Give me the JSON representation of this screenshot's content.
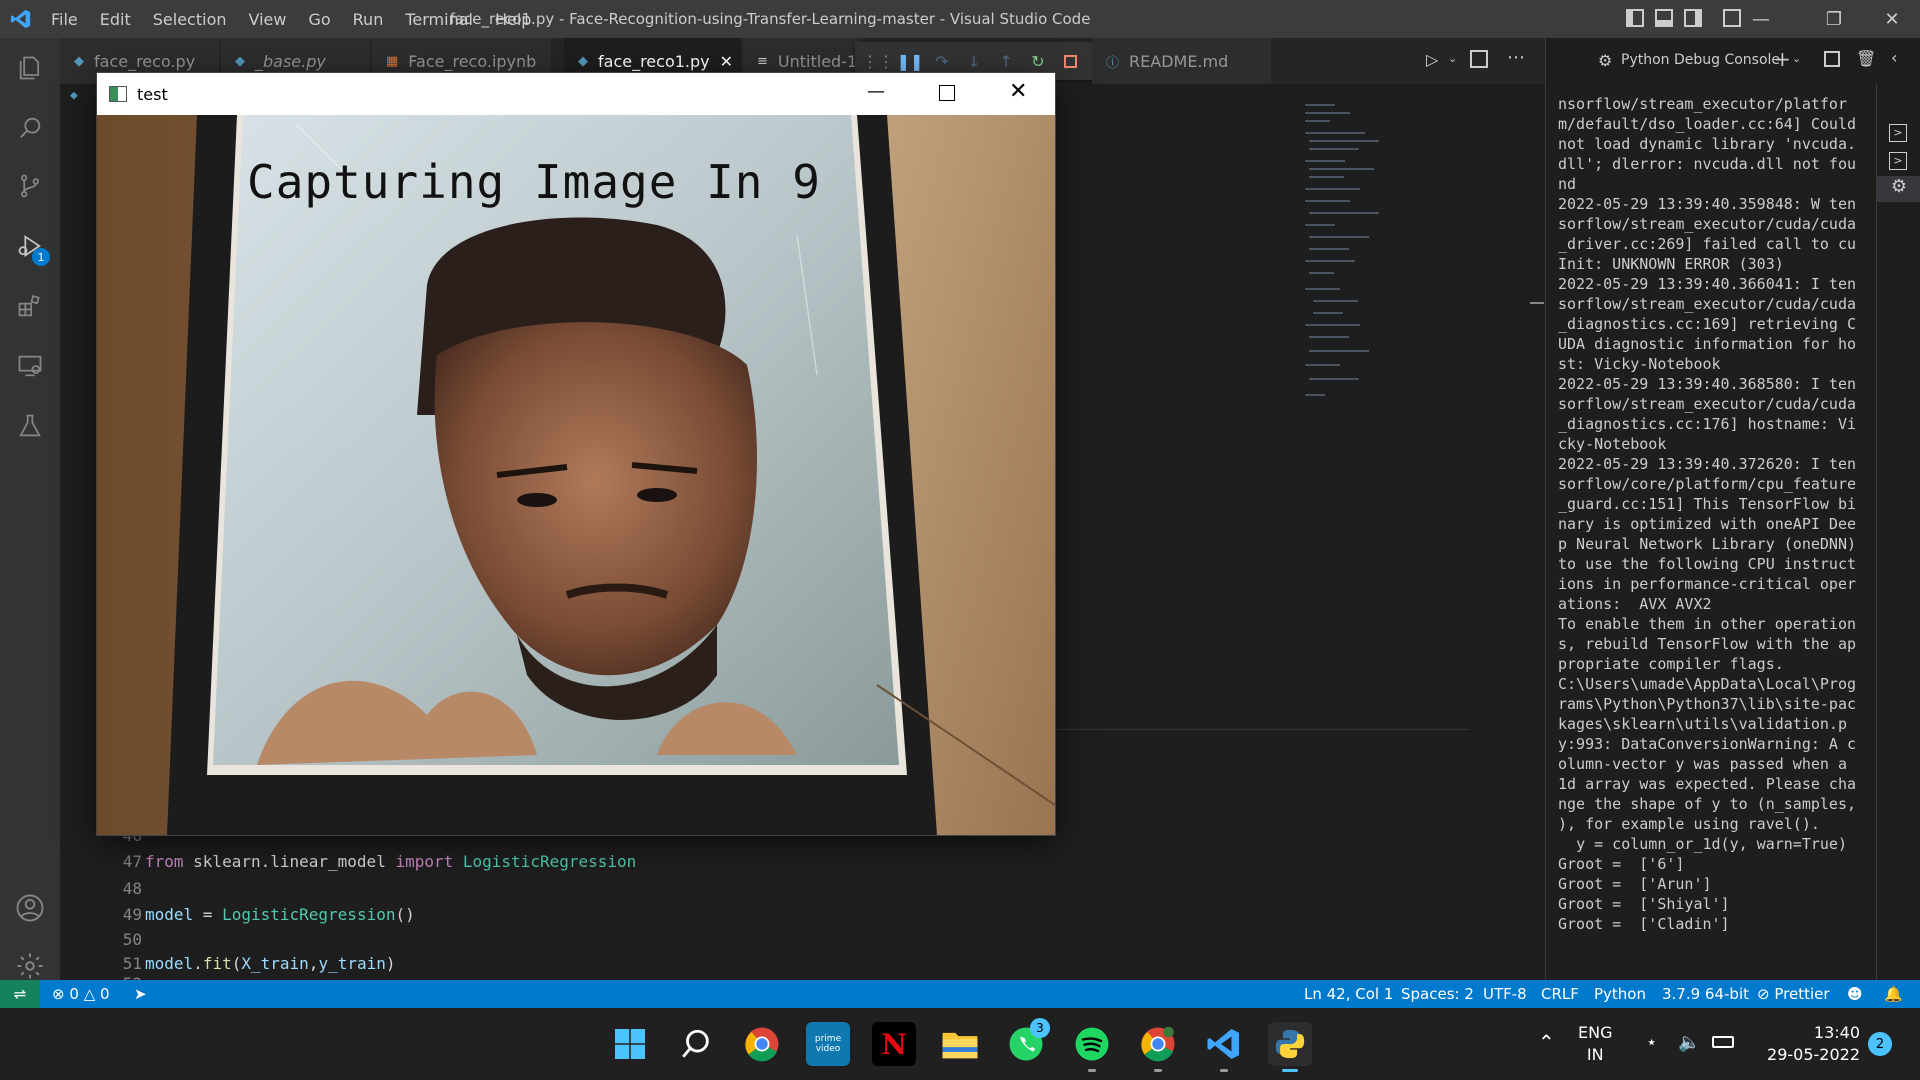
{
  "window": {
    "title": "face_reco1.py - Face-Recognition-using-Transfer-Learning-master - Visual Studio Code",
    "menu": [
      "File",
      "Edit",
      "Selection",
      "View",
      "Go",
      "Run",
      "Terminal",
      "Help"
    ]
  },
  "tabs": [
    {
      "label": "face_reco.py"
    },
    {
      "label": "_base.py"
    },
    {
      "label": "Face_reco.ipynb"
    },
    {
      "label": "face_reco1.py"
    },
    {
      "label": "Untitled-1"
    },
    {
      "label": "README.md"
    }
  ],
  "activity": {
    "debug_badge": "1"
  },
  "editor": {
    "lines": [
      {
        "num": "46",
        "code": ""
      },
      {
        "num": "47",
        "kw": "from",
        "mod": " sklearn.linear_model ",
        "kw2": "import",
        "cls": " LogisticRegression"
      },
      {
        "num": "48",
        "code": ""
      },
      {
        "num": "49",
        "var": "model",
        "op": " = ",
        "cls": "LogisticRegression",
        "rest": "()"
      },
      {
        "num": "50",
        "code": ""
      },
      {
        "num": "51",
        "var": "model",
        "dot": ".",
        "fn": "fit",
        "open": "(",
        "a1": "X_train",
        "comma": ",",
        "a2": "y_train",
        "close": ")"
      },
      {
        "num": "52",
        "code": ""
      }
    ]
  },
  "panel": {
    "title": "Python Debug Console",
    "output": "nsorflow/stream_executor/platform/default/dso_loader.cc:64] Could not load dynamic library 'nvcuda.dll'; dlerror: nvcuda.dll not found\n2022-05-29 13:39:40.359848: W tensorflow/stream_executor/cuda/cuda_driver.cc:269] failed call to cuInit: UNKNOWN ERROR (303)\n2022-05-29 13:39:40.366041: I tensorflow/stream_executor/cuda/cuda_diagnostics.cc:169] retrieving CUDA diagnostic information for host: Vicky-Notebook\n2022-05-29 13:39:40.368580: I tensorflow/stream_executor/cuda/cuda_diagnostics.cc:176] hostname: Vicky-Notebook\n2022-05-29 13:39:40.372620: I tensorflow/core/platform/cpu_feature_guard.cc:151] This TensorFlow binary is optimized with oneAPI Deep Neural Network Library (oneDNN) to use the following CPU instructions in performance-critical operations:  AVX AVX2\nTo enable them in other operations, rebuild TensorFlow with the appropriate compiler flags.\nC:\\Users\\umade\\AppData\\Local\\Programs\\Python\\Python37\\lib\\site-packages\\sklearn\\utils\\validation.py:993: DataConversionWarning: A column-vector y was passed when a 1d array was expected. Please change the shape of y to (n_samples, ), for example using ravel().\n  y = column_or_1d(y, warn=True)\nGroot =  ['6']\nGroot =  ['Arun']\nGroot =  ['Shiyal']\nGroot =  ['Cladin']"
  },
  "camera_window": {
    "title": "test",
    "overlay": "Capturing Image In 9"
  },
  "statusbar": {
    "errors": "0",
    "warnings": "0",
    "position": "Ln 42, Col 1",
    "spaces": "Spaces: 2",
    "encoding": "UTF-8",
    "eol": "CRLF",
    "language": "Python",
    "interpreter": "3.7.9 64-bit",
    "formatter": "Prettier"
  },
  "taskbar": {
    "whatsapp_badge": "3",
    "lang": "ENG",
    "region": "IN",
    "time": "13:40",
    "date": "29-05-2022",
    "notif_count": "2",
    "prime_label": "prime video"
  },
  "colors": {
    "accent": "#007acc",
    "titlebar": "#3c3c3c",
    "editor_bg": "#1e1e1e"
  }
}
